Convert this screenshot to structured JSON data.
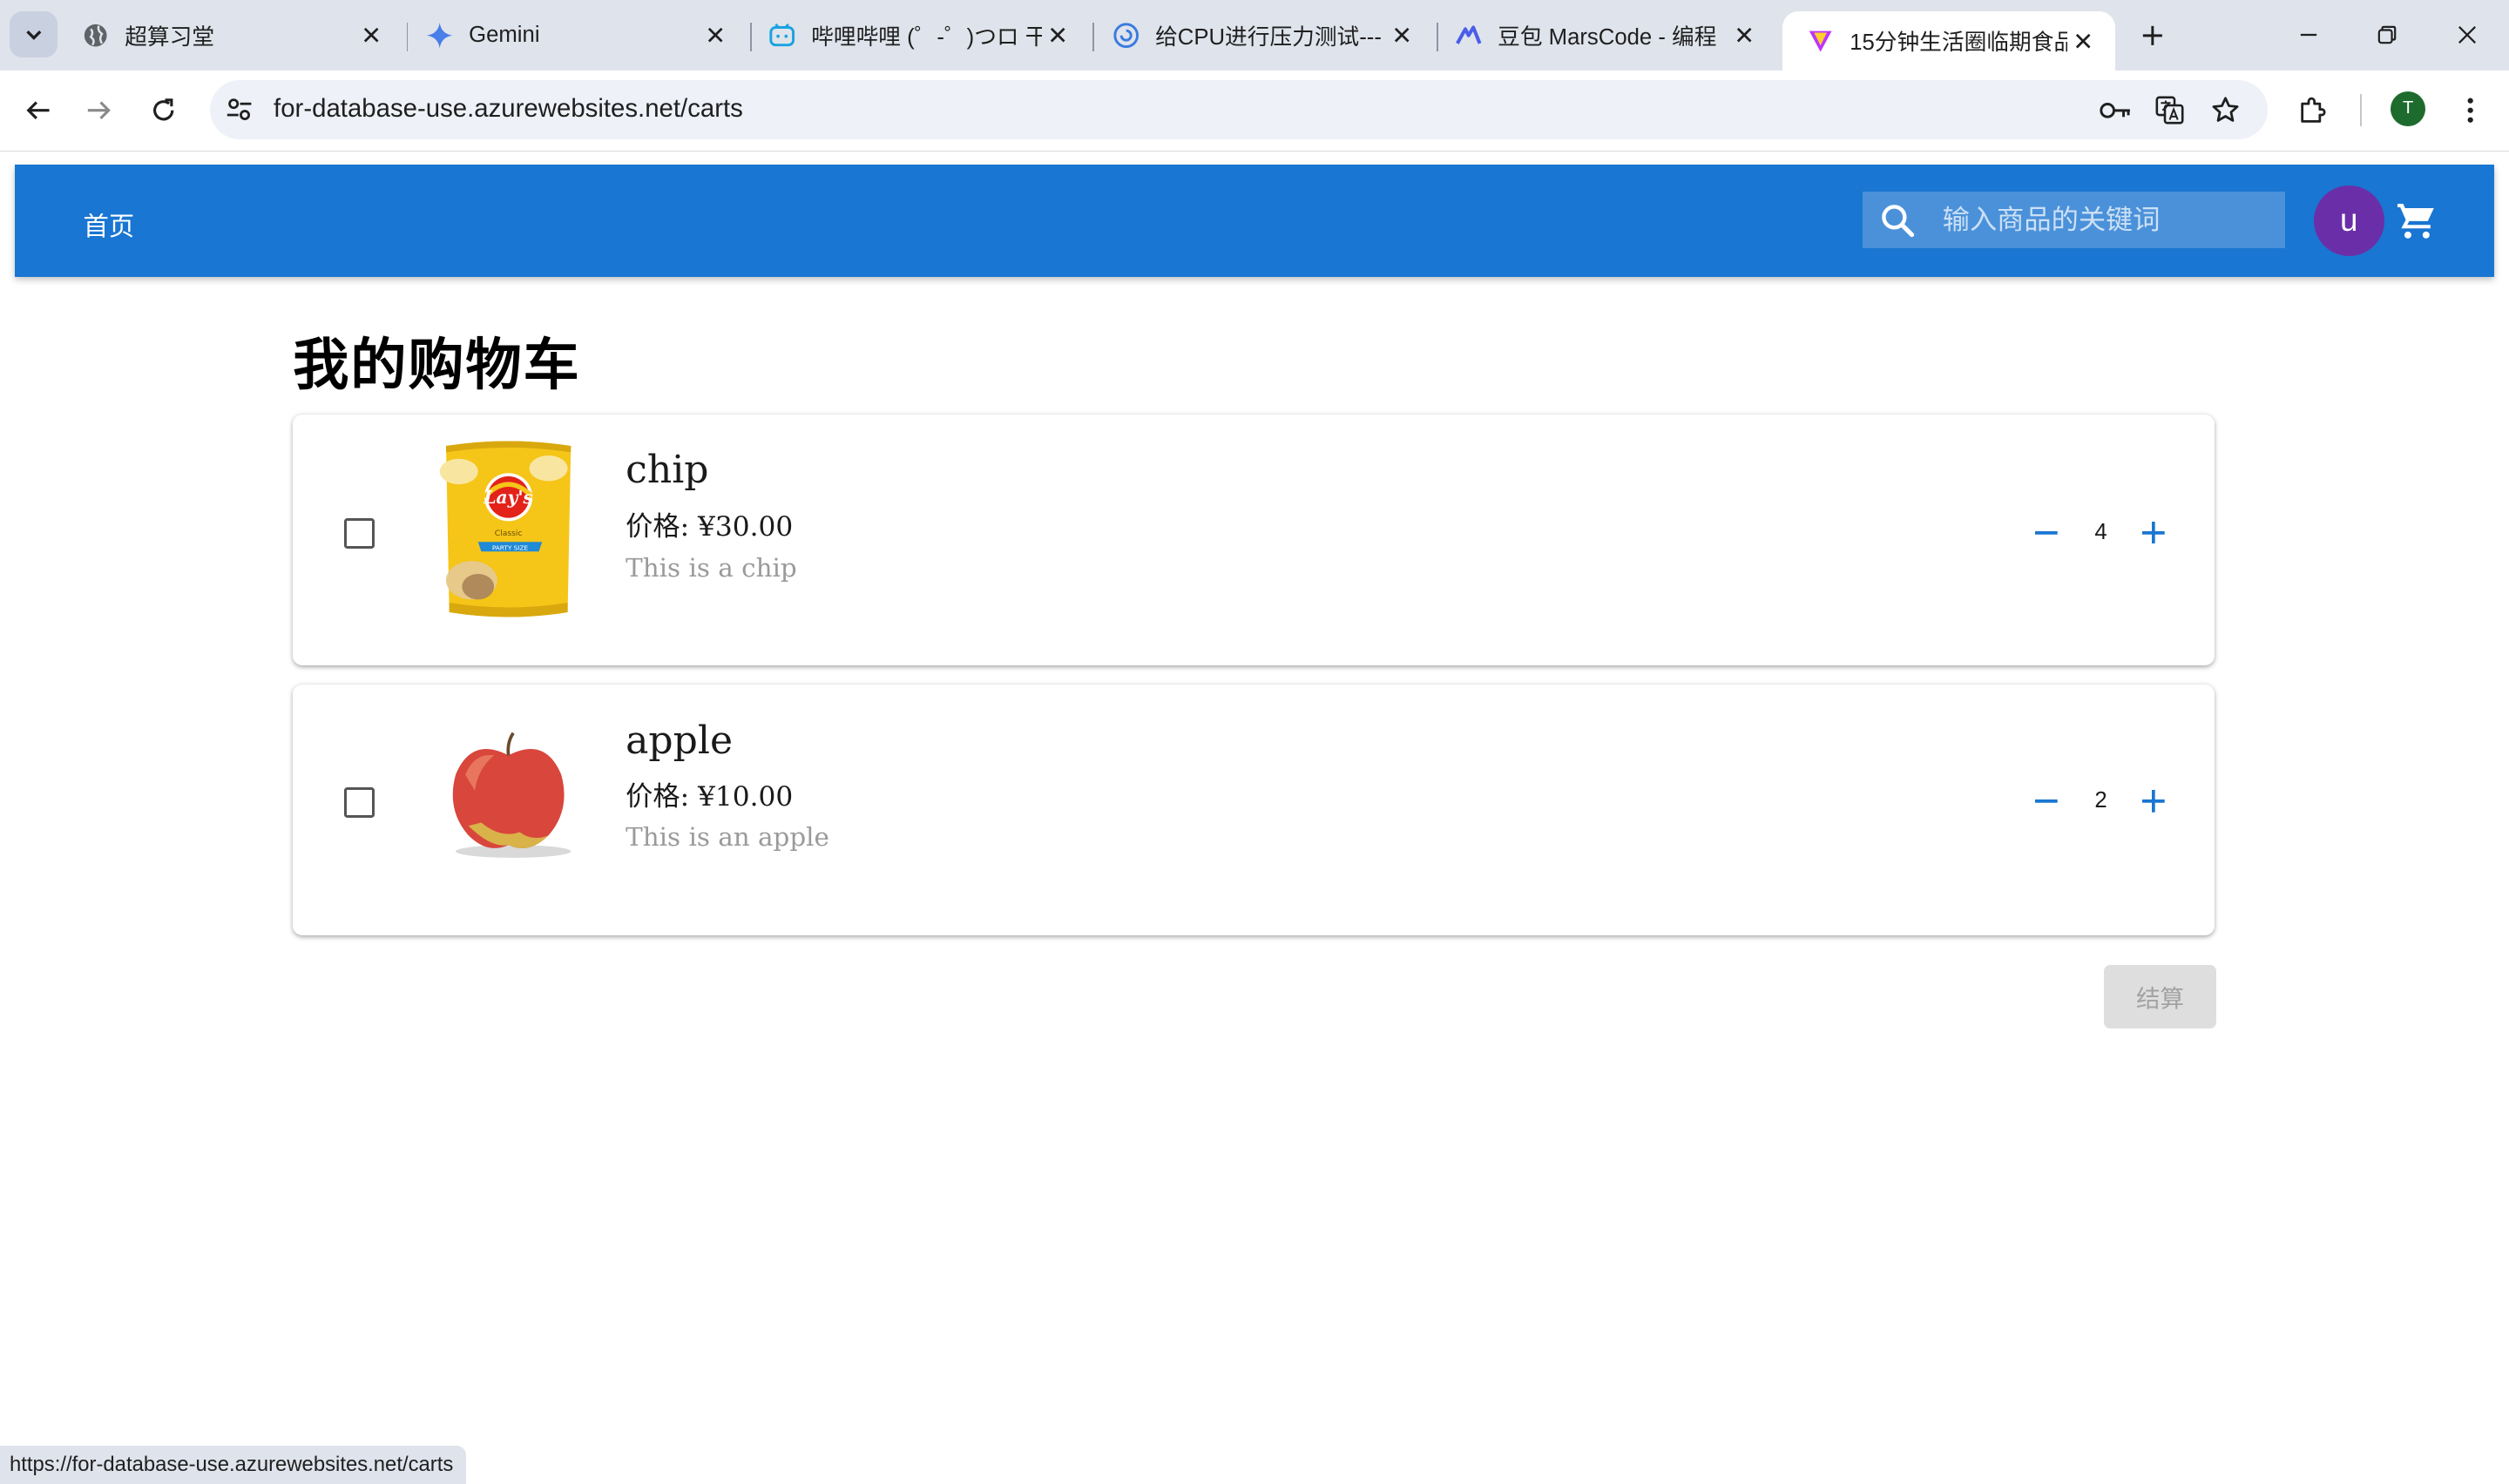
{
  "browser": {
    "tabs": [
      {
        "title": "超算习堂",
        "active": false
      },
      {
        "title": "Gemini",
        "active": false
      },
      {
        "title": "哔哩哔哩 (゜-゜)つロ 干",
        "active": false
      },
      {
        "title": "给CPU进行压力测试---",
        "active": false
      },
      {
        "title": "豆包 MarsCode - 编程",
        "active": false
      },
      {
        "title": "15分钟生活圈临期食品",
        "active": true
      }
    ],
    "url": "for-database-use.azurewebsites.net/carts",
    "profile_initial": "T",
    "status_url": "https://for-database-use.azurewebsites.net/carts"
  },
  "header": {
    "home_label": "首页",
    "search_placeholder": "输入商品的关键词",
    "avatar_initial": "u"
  },
  "page": {
    "title": "我的购物车",
    "checkout_label": "结算"
  },
  "cart": {
    "items": [
      {
        "name": "chip",
        "price": "价格: ¥30.00",
        "description": "This is a chip",
        "quantity": "4",
        "checked": false,
        "image": "chips-bag"
      },
      {
        "name": "apple",
        "price": "价格: ¥10.00",
        "description": "This is an apple",
        "quantity": "2",
        "checked": false,
        "image": "red-apple"
      }
    ]
  },
  "colors": {
    "appbar": "#1976d2",
    "accent": "#1976d2",
    "avatar": "#6a2fa8",
    "checkout_disabled_bg": "#dedede"
  }
}
